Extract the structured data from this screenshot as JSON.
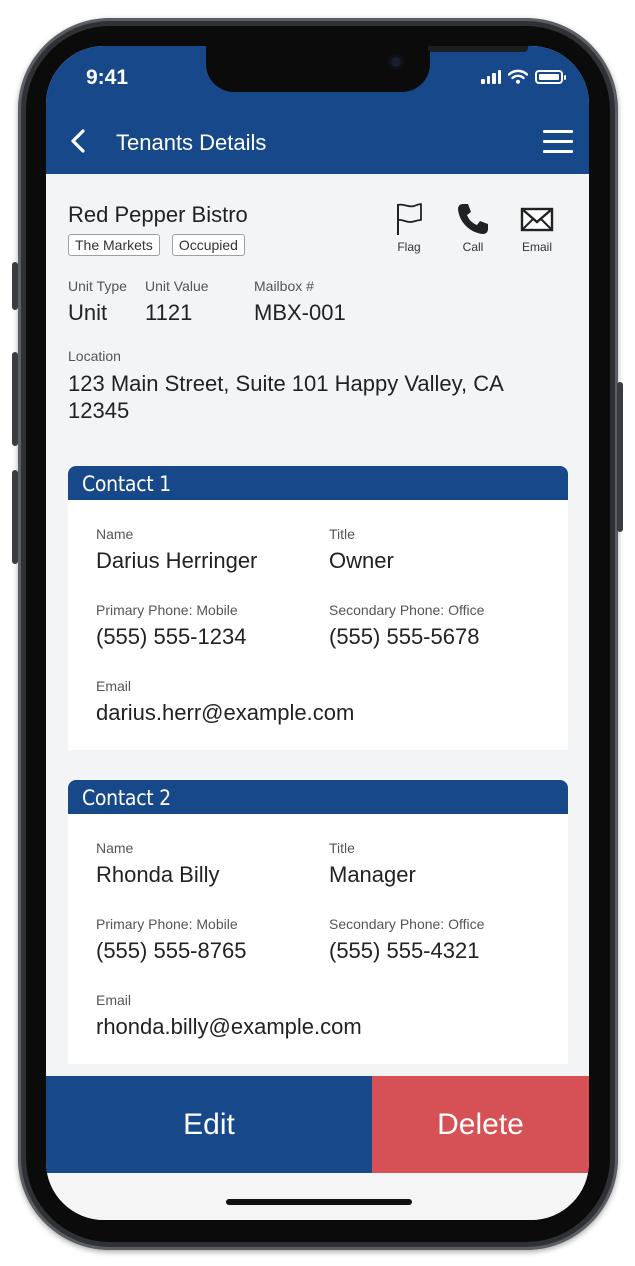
{
  "status_bar": {
    "time": "9:41"
  },
  "nav": {
    "title": "Tenants Details"
  },
  "tenant": {
    "name": "Red Pepper Bistro",
    "tags": [
      "The Markets",
      "Occupied"
    ],
    "actions": {
      "flag": "Flag",
      "call": "Call",
      "email": "Email"
    },
    "unit_type_label": "Unit Type",
    "unit_type_value": "Unit",
    "unit_value_label": "Unit Value",
    "unit_value_value": "1121",
    "mailbox_label": "Mailbox #",
    "mailbox_value": "MBX-001",
    "location_label": "Location",
    "location_value": "123 Main Street, Suite 101 Happy Valley, CA 12345"
  },
  "contacts": [
    {
      "heading": "Contact 1",
      "name_label": "Name",
      "name": "Darius Herringer",
      "title_label": "Title",
      "title": "Owner",
      "primary_label": "Primary Phone: Mobile",
      "primary": "(555) 555-1234",
      "secondary_label": "Secondary Phone: Office",
      "secondary": "(555) 555-5678",
      "email_label": "Email",
      "email": "darius.herr@example.com"
    },
    {
      "heading": "Contact 2",
      "name_label": "Name",
      "name": "Rhonda Billy",
      "title_label": "Title",
      "title": "Manager",
      "primary_label": "Primary Phone: Mobile",
      "primary": "(555) 555-8765",
      "secondary_label": "Secondary Phone: Office",
      "secondary": "(555) 555-4321",
      "email_label": "Email",
      "email": "rhonda.billy@example.com"
    }
  ],
  "footer": {
    "edit_label": "Edit",
    "delete_label": "Delete"
  },
  "colors": {
    "primary": "#17498a",
    "danger": "#d65156",
    "background": "#f3f4f6"
  },
  "icons": [
    "back-chevron-icon",
    "hamburger-menu-icon",
    "flag-icon",
    "phone-icon",
    "envelope-icon",
    "signal-icon",
    "wifi-icon",
    "battery-icon"
  ]
}
